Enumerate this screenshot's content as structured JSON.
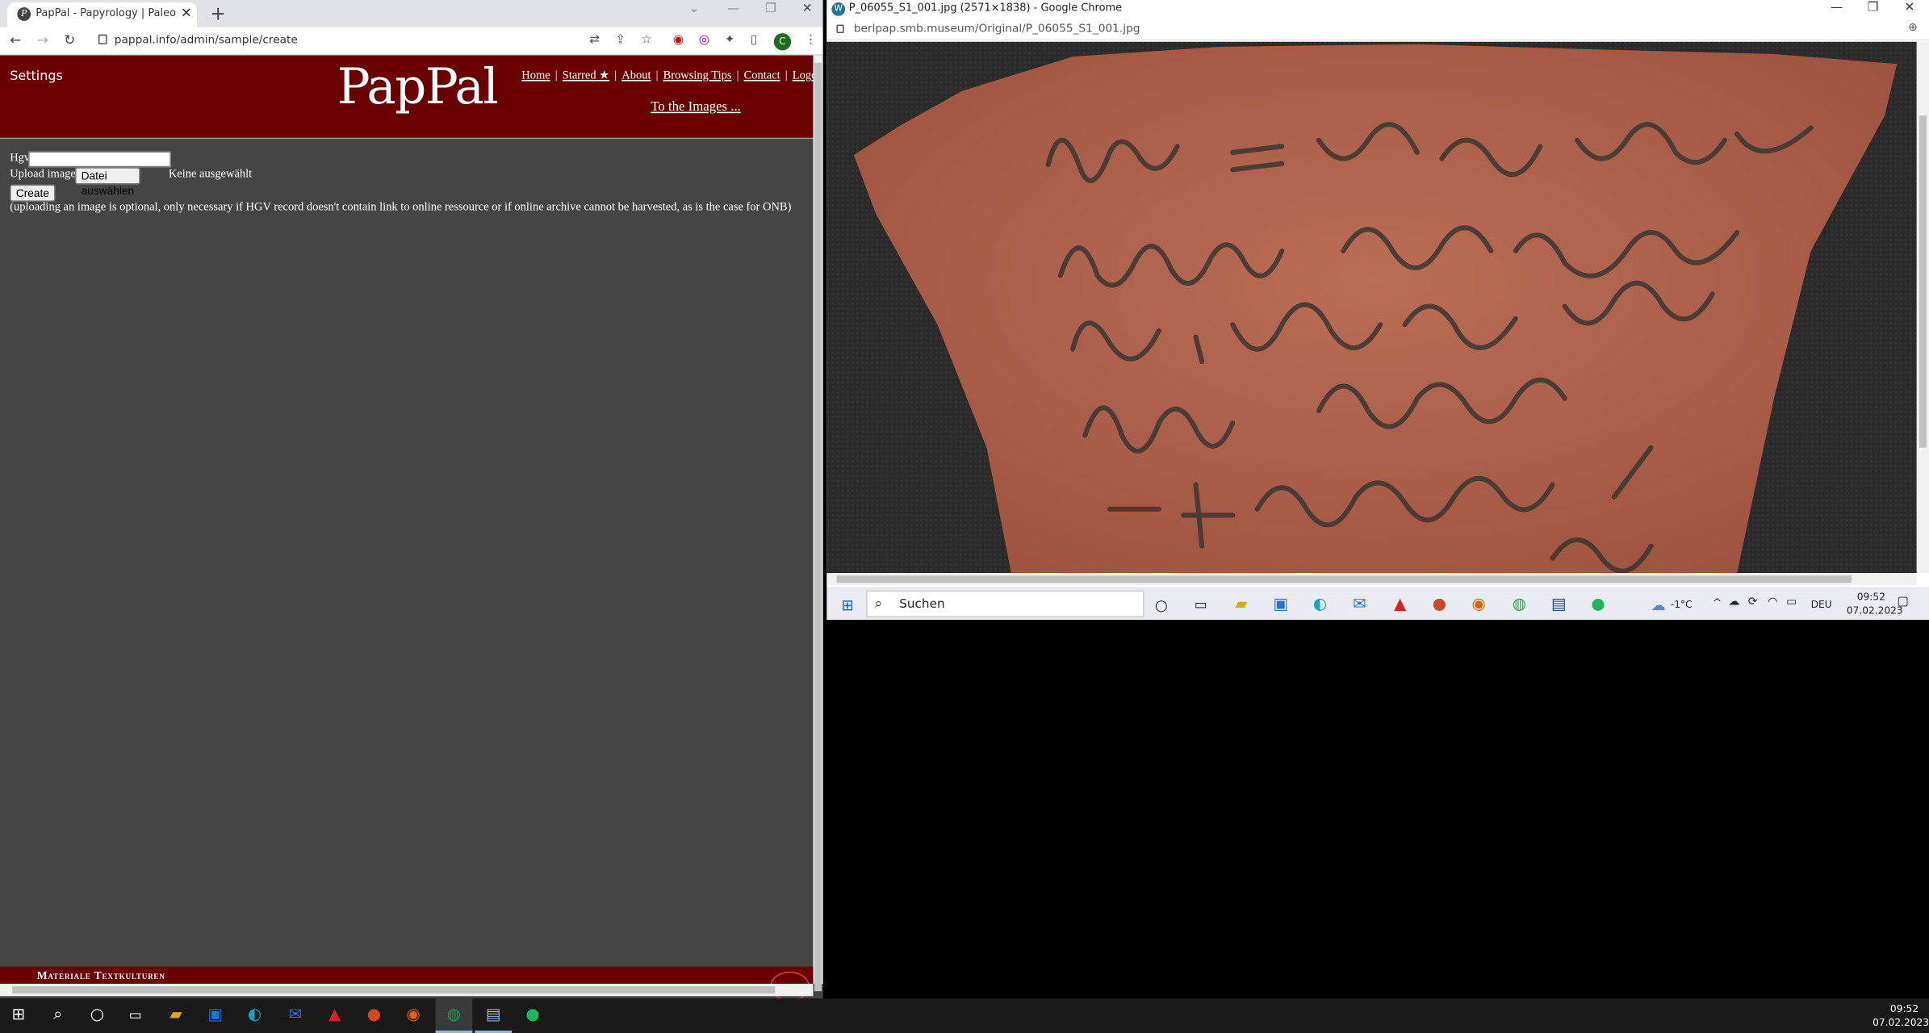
{
  "left_window": {
    "tab_title": "PapPal - Papyrology | Paleograph",
    "url": "pappal.info/admin/sample/create",
    "avatar_letter": "C",
    "site": {
      "settings_label": "Settings",
      "logo": "PapPal",
      "nav": [
        "Home",
        "Starred ★",
        "About",
        "Browsing Tips",
        "Contact",
        "Logou"
      ],
      "to_images": "To the Images ..."
    },
    "form": {
      "hgv_label": "Hgv",
      "hgv_value": "",
      "upload_label": "Upload image",
      "file_button": "Datei auswählen",
      "file_status": "Keine ausgewählt",
      "create_button": "Create",
      "note": "(uploading an image is optional, only necessary if HGV record doesn't contain link to online ressource or if online archive cannot be harvested, as is the case for ONB)"
    },
    "footer_text": "Materiale Textkulturen"
  },
  "right_window": {
    "title": "P_06055_S1_001.jpg (2571×1838) - Google Chrome",
    "url": "berlpap.smb.museum/Original/P_06055_S1_001.jpg",
    "taskbar": {
      "search_placeholder": "Suchen",
      "weather": "-1°C",
      "lang": "DEU",
      "time": "09:52",
      "date": "07.02.2023"
    }
  },
  "taskbar": {
    "time": "09:52",
    "date": "07.02.2023"
  },
  "colors": {
    "header_red": "#6b0000",
    "page_bg": "#454545",
    "sherd": "#b0634d"
  }
}
